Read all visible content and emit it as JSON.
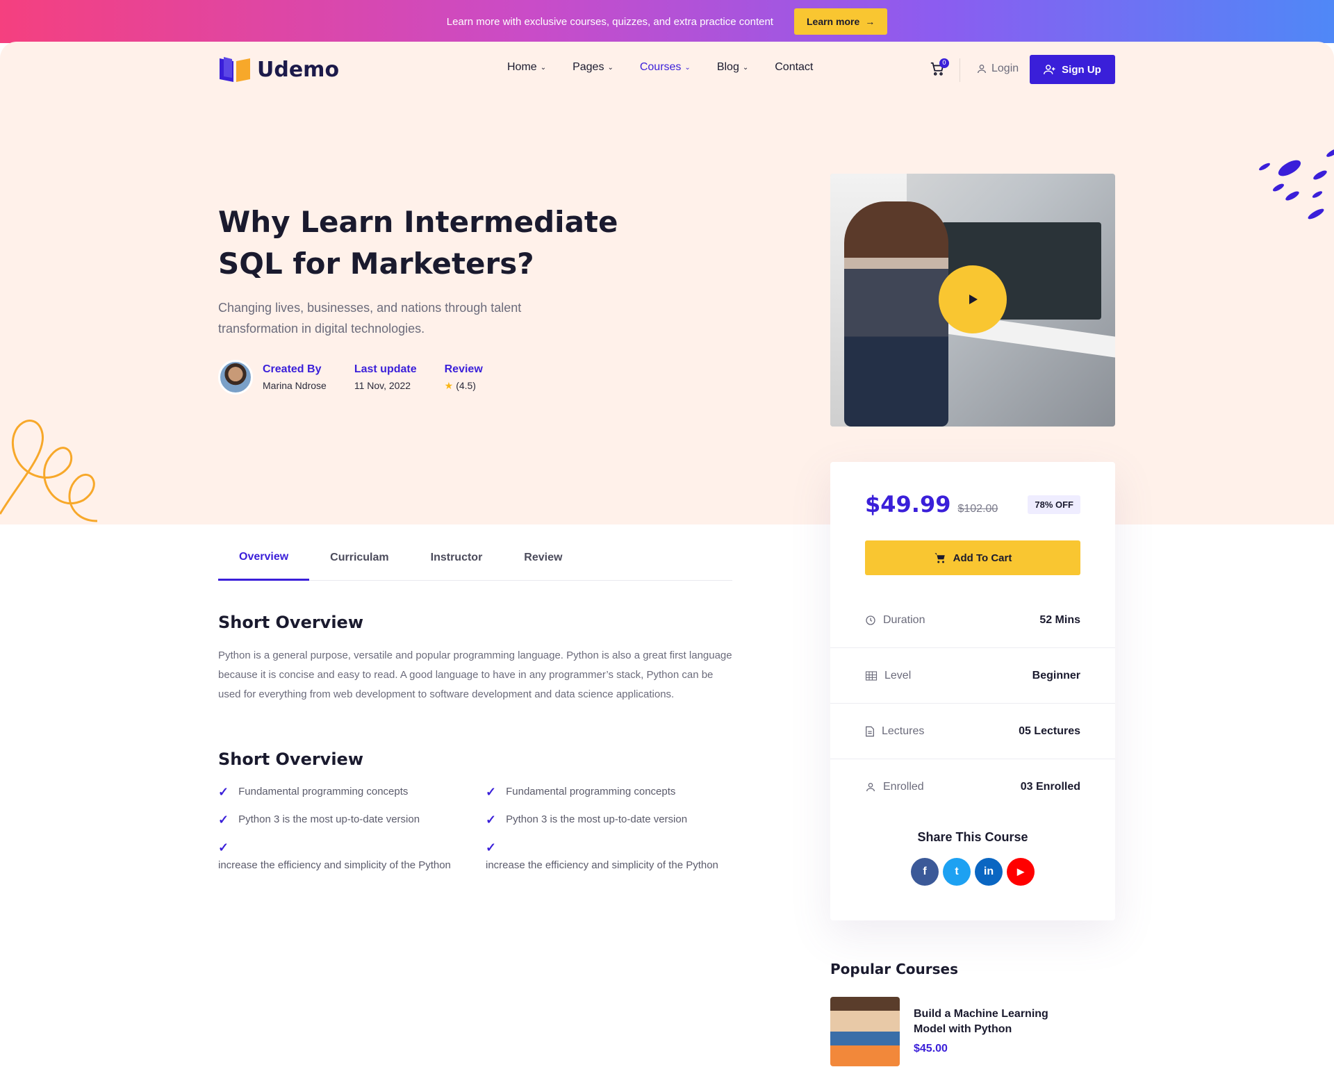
{
  "topbar": {
    "text": "Learn more with exclusive courses, quizzes, and extra practice content",
    "button_label": "Learn more"
  },
  "header": {
    "logo_text": "Udemo",
    "nav": [
      {
        "label": "Home",
        "has_dropdown": true
      },
      {
        "label": "Pages",
        "has_dropdown": true
      },
      {
        "label": "Courses",
        "has_dropdown": true,
        "active": true
      },
      {
        "label": "Blog",
        "has_dropdown": true
      },
      {
        "label": "Contact",
        "has_dropdown": false
      }
    ],
    "cart_count": "0",
    "login_label": "Login",
    "signup_label": "Sign Up"
  },
  "hero": {
    "title": "Why Learn Intermediate SQL for Marketers?",
    "subtitle": "Changing lives, businesses, and nations through talent transformation in digital technologies.",
    "meta": {
      "created_label": "Created By",
      "created_value": "Marina Ndrose",
      "update_label": "Last update",
      "update_value": "11 Nov, 2022",
      "review_label": "Review",
      "review_value": "(4.5)"
    }
  },
  "tabs": [
    "Overview",
    "Curriculam",
    "Instructor",
    "Review"
  ],
  "content": {
    "heading1": "Short Overview",
    "paragraph": "Python is a general  purpose, versatile and popular programming language. Python is also a great first language because it is concise and easy to read. A good language to have in any programmer’s stack, Python can be used for everything from web development to software development and data science applications.",
    "heading2": "Short Overview",
    "checklist_left": [
      "Fundamental programming concepts",
      "Python 3 is the most up-to-date version",
      "increase the efficiency and simplicity of the Python"
    ],
    "checklist_right": [
      "Fundamental programming concepts",
      "Python 3 is the most up-to-date version",
      "increase the efficiency and simplicity of the Python"
    ]
  },
  "sidebar": {
    "price": "$49.99",
    "old_price": "$102.00",
    "discount": "78% OFF",
    "cart_label": "Add To Cart",
    "info": [
      {
        "label": "Duration",
        "value": "52 Mins",
        "icon": "clock-icon"
      },
      {
        "label": "Level",
        "value": "Beginner",
        "icon": "level-icon"
      },
      {
        "label": "Lectures",
        "value": "05 Lectures",
        "icon": "document-icon"
      },
      {
        "label": "Enrolled",
        "value": "03 Enrolled",
        "icon": "user-icon"
      }
    ],
    "share_title": "Share This Course",
    "socials": [
      {
        "name": "facebook",
        "glyph": "f",
        "color": "#3b5998"
      },
      {
        "name": "twitter",
        "glyph": "t",
        "color": "#1da1f2"
      },
      {
        "name": "linkedin",
        "glyph": "in",
        "color": "#0a66c2"
      },
      {
        "name": "youtube",
        "glyph": "▶",
        "color": "#ff0000"
      }
    ]
  },
  "popular": {
    "title": "Popular Courses",
    "items": [
      {
        "name": "Build a Machine Learning Model with Python",
        "price": "$45.00"
      }
    ]
  },
  "colors": {
    "accent": "#3a1fd9",
    "yellow": "#f9c631",
    "hero_bg": "#fff1ea"
  }
}
